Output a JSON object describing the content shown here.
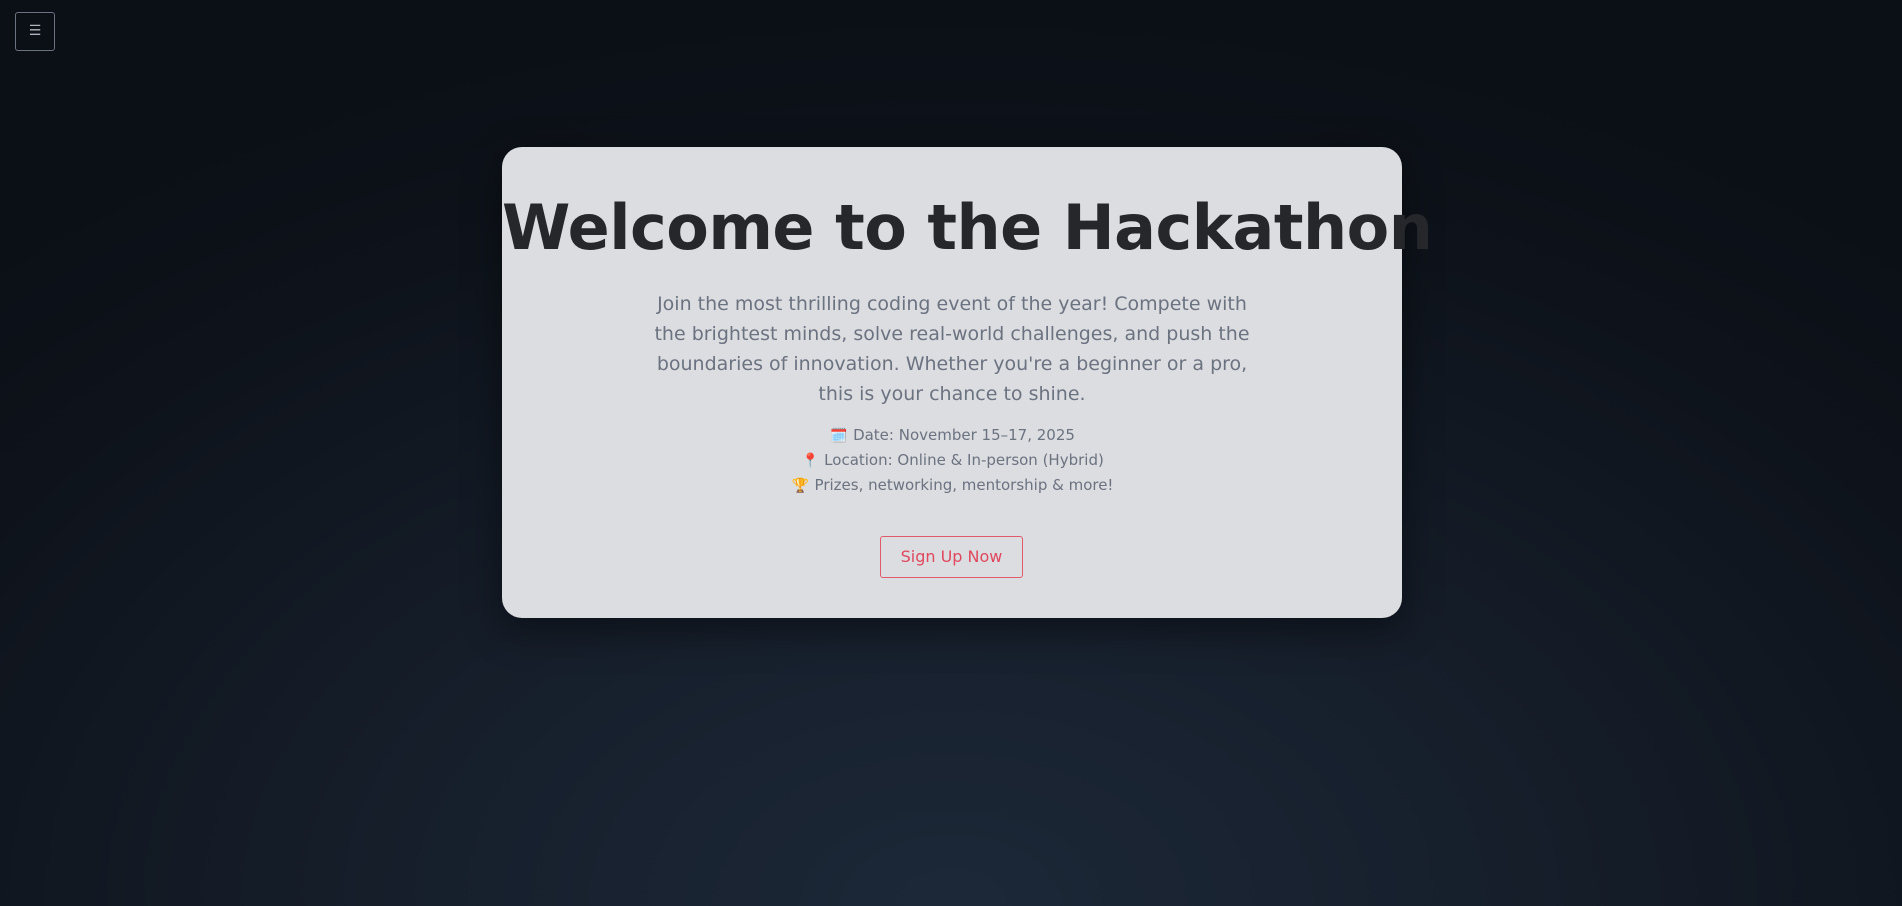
{
  "menu": {
    "icon": "hamburger-icon",
    "glyph": "☰"
  },
  "hero": {
    "title": "Welcome to the Hackathon",
    "intro": "Join the most thrilling coding event of the year! Compete with the brightest minds, solve real-world challenges, and push the boundaries of innovation. Whether you're a beginner or a pro, this is your chance to shine.",
    "details": [
      {
        "icon": "calendar-icon",
        "emoji": "🗓️",
        "text": "Date: November 15–17, 2025"
      },
      {
        "icon": "location-pin-icon",
        "emoji": "📍",
        "text": "Location: Online & In-person (Hybrid)"
      },
      {
        "icon": "trophy-icon",
        "emoji": "🏆",
        "text": "Prizes, networking, mentorship & more!"
      }
    ],
    "cta_label": "Sign Up Now"
  },
  "colors": {
    "background": "#0f151e",
    "card": "#dcdde0",
    "title": "#25272b",
    "body_text": "#6b7280",
    "accent": "#e0485e"
  }
}
